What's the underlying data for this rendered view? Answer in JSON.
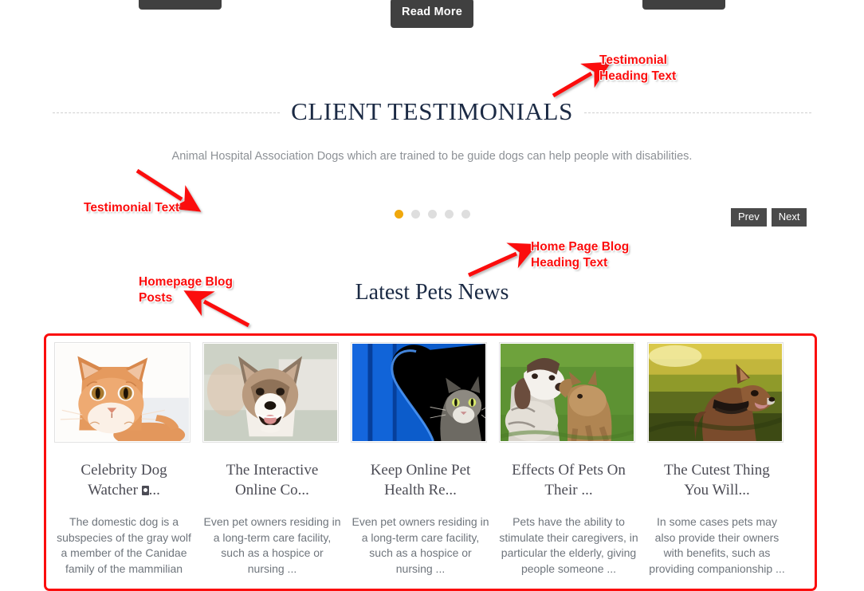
{
  "top_buttons": [
    {
      "name": "left-cta-button",
      "label": ""
    },
    {
      "name": "read-more-button",
      "label": "Read More"
    },
    {
      "name": "right-cta-button",
      "label": ""
    }
  ],
  "testimonials": {
    "heading": "CLIENT TESTIMONIALS",
    "text": "Animal Hospital Association Dogs which are trained to be guide dogs can help people with disabilities.",
    "dots": [
      {
        "active": true
      },
      {
        "active": false
      },
      {
        "active": false
      },
      {
        "active": false
      },
      {
        "active": false
      }
    ],
    "prev_label": "Prev",
    "next_label": "Next",
    "active_dot_color": "#f0a80c",
    "inactive_dot_color": "#dedede"
  },
  "news": {
    "heading": "Latest Pets News",
    "posts": [
      {
        "title_part1": "Celebrity Dog",
        "title_part2": "Watcher ",
        "title_glyph": true,
        "title_part3": "...",
        "excerpt": "The domestic dog  is a subspecies of the gray wolf  a member of the Canidae family of the mammilian",
        "image": "orange-tabby-cat"
      },
      {
        "title_part1": "The Interactive",
        "title_part2": "Online Co...",
        "title_glyph": false,
        "title_part3": "",
        "excerpt": "Even pet owners residing in a long-term care facility, such as a hospice or nursing ...",
        "image": "corgi-dog-smiling"
      },
      {
        "title_part1": "Keep Online Pet",
        "title_part2": "Health Re...",
        "title_glyph": false,
        "title_part3": "",
        "excerpt": "Even pet owners residing in a long-term care facility, such as a hospice or nursing ...",
        "image": "cat-in-blue-heart-door"
      },
      {
        "title_part1": "Effects Of Pets On",
        "title_part2": "Their ...",
        "title_glyph": false,
        "title_part3": "",
        "excerpt": "Pets have the ability to stimulate their caregivers, in particular the elderly, giving people someone ...",
        "image": "pointer-dog-with-fawn"
      },
      {
        "title_part1": "The Cutest Thing",
        "title_part2": "You Will...",
        "title_glyph": false,
        "title_part3": "",
        "excerpt": "In some cases pets may also provide their owners with benefits, such as providing companionship ...",
        "image": "brown-dog-in-field"
      }
    ]
  },
  "annotations": {
    "color": "#fb0d0d",
    "labels": [
      {
        "name": "annotation-testimonial-heading-text",
        "line1": "Testimonial",
        "line2": "Heading Text"
      },
      {
        "name": "annotation-testimonial-text",
        "line1": "Testimonial Text",
        "line2": ""
      },
      {
        "name": "annotation-home-page-blog-heading",
        "line1": "Home Page Blog",
        "line2": "Heading Text"
      },
      {
        "name": "annotation-homepage-blog-posts",
        "line1": "Homepage Blog",
        "line2": "Posts"
      }
    ]
  }
}
